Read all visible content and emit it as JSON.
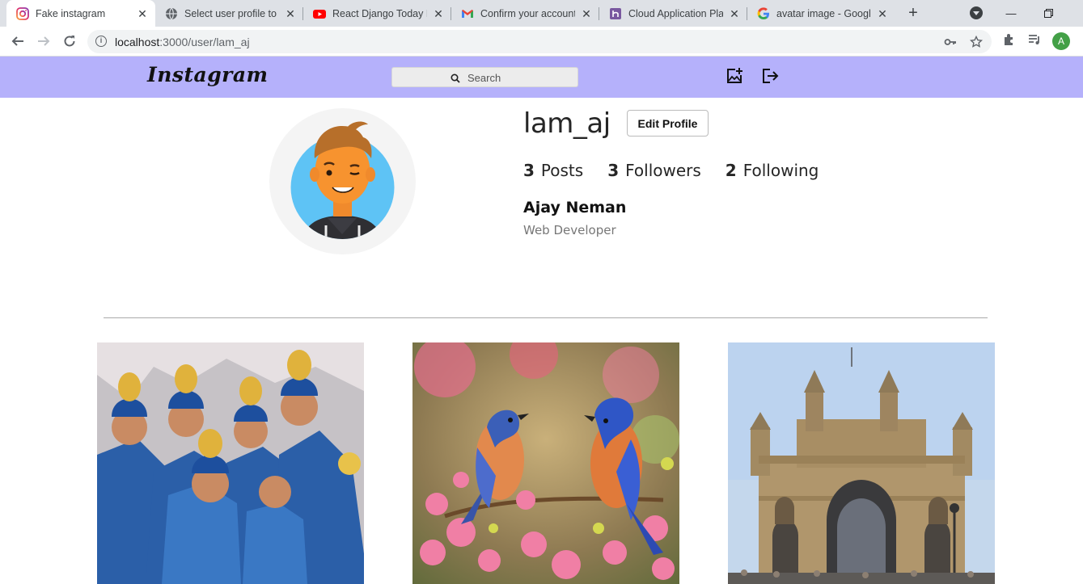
{
  "browser": {
    "tabs": [
      {
        "title": "Fake instagram",
        "icon": "instagram-favicon",
        "active": true
      },
      {
        "title": "Select user profile to c",
        "icon": "globe-favicon",
        "active": false
      },
      {
        "title": "React Django Today Pl",
        "icon": "youtube-favicon",
        "active": false
      },
      {
        "title": "Confirm your account",
        "icon": "gmail-favicon",
        "active": false
      },
      {
        "title": "Cloud Application Plat",
        "icon": "heroku-favicon",
        "active": false
      },
      {
        "title": "avatar image - Google",
        "icon": "google-favicon",
        "active": false
      }
    ],
    "url_host": "localhost",
    "url_path": ":3000/user/lam_aj",
    "profile_initial": "A"
  },
  "header": {
    "logo": "Instagram",
    "search_placeholder": "Search",
    "background": "#b5b1fb"
  },
  "profile": {
    "username": "lam_aj",
    "edit_label": "Edit Profile",
    "stats": [
      {
        "count": "3",
        "label": "Posts"
      },
      {
        "count": "3",
        "label": "Followers"
      },
      {
        "count": "2",
        "label": "Following"
      }
    ],
    "full_name": "Ajay Neman",
    "bio": "Web Developer"
  },
  "posts": [
    {
      "image": "cricket-team-photo"
    },
    {
      "image": "two-bluebirds-on-blossoms-photo"
    },
    {
      "image": "gateway-of-india-photo"
    }
  ]
}
